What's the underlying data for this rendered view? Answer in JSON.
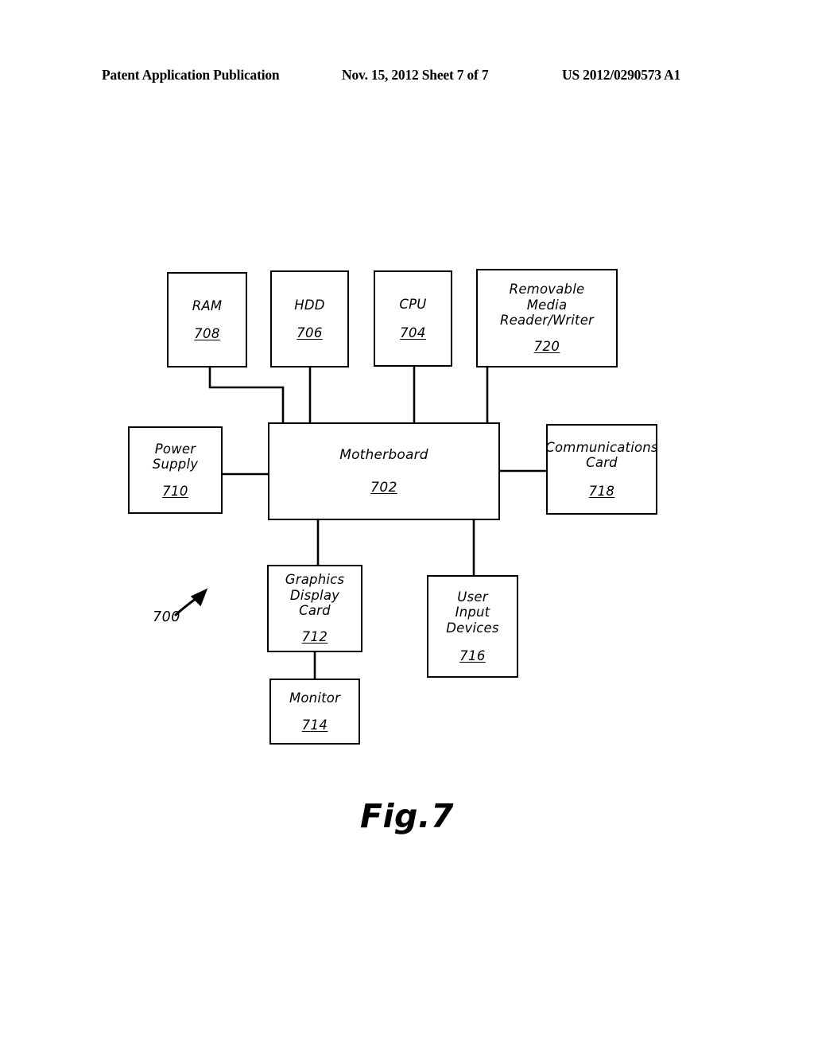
{
  "header": {
    "publication": "Patent Application Publication",
    "date_sheet": "Nov. 15, 2012  Sheet 7 of 7",
    "patent_number": "US 2012/0290573 A1"
  },
  "figure": {
    "caption": "Fig.7",
    "system_ref": "700"
  },
  "diagram": {
    "type": "block-diagram",
    "line_color": "#000000",
    "background": "#ffffff",
    "nodes": [
      {
        "id": "ram",
        "label": "RAM",
        "ref": "708"
      },
      {
        "id": "hdd",
        "label": "HDD",
        "ref": "706"
      },
      {
        "id": "cpu",
        "label": "CPU",
        "ref": "704"
      },
      {
        "id": "removable",
        "label": "Removable\nMedia\nReader/Writer",
        "ref": "720"
      },
      {
        "id": "power",
        "label": "Power\nSupply",
        "ref": "710"
      },
      {
        "id": "motherboard",
        "label": "Motherboard",
        "ref": "702"
      },
      {
        "id": "comms",
        "label": "Communications\nCard",
        "ref": "718"
      },
      {
        "id": "graphics",
        "label": "Graphics\nDisplay\nCard",
        "ref": "712"
      },
      {
        "id": "userinput",
        "label": "User\nInput\nDevices",
        "ref": "716"
      },
      {
        "id": "monitor",
        "label": "Monitor",
        "ref": "714"
      }
    ],
    "connections": [
      {
        "from": "ram",
        "to": "motherboard"
      },
      {
        "from": "hdd",
        "to": "motherboard"
      },
      {
        "from": "cpu",
        "to": "motherboard"
      },
      {
        "from": "removable",
        "to": "motherboard"
      },
      {
        "from": "power",
        "to": "motherboard"
      },
      {
        "from": "motherboard",
        "to": "comms"
      },
      {
        "from": "motherboard",
        "to": "graphics"
      },
      {
        "from": "motherboard",
        "to": "userinput"
      },
      {
        "from": "graphics",
        "to": "monitor"
      }
    ]
  }
}
